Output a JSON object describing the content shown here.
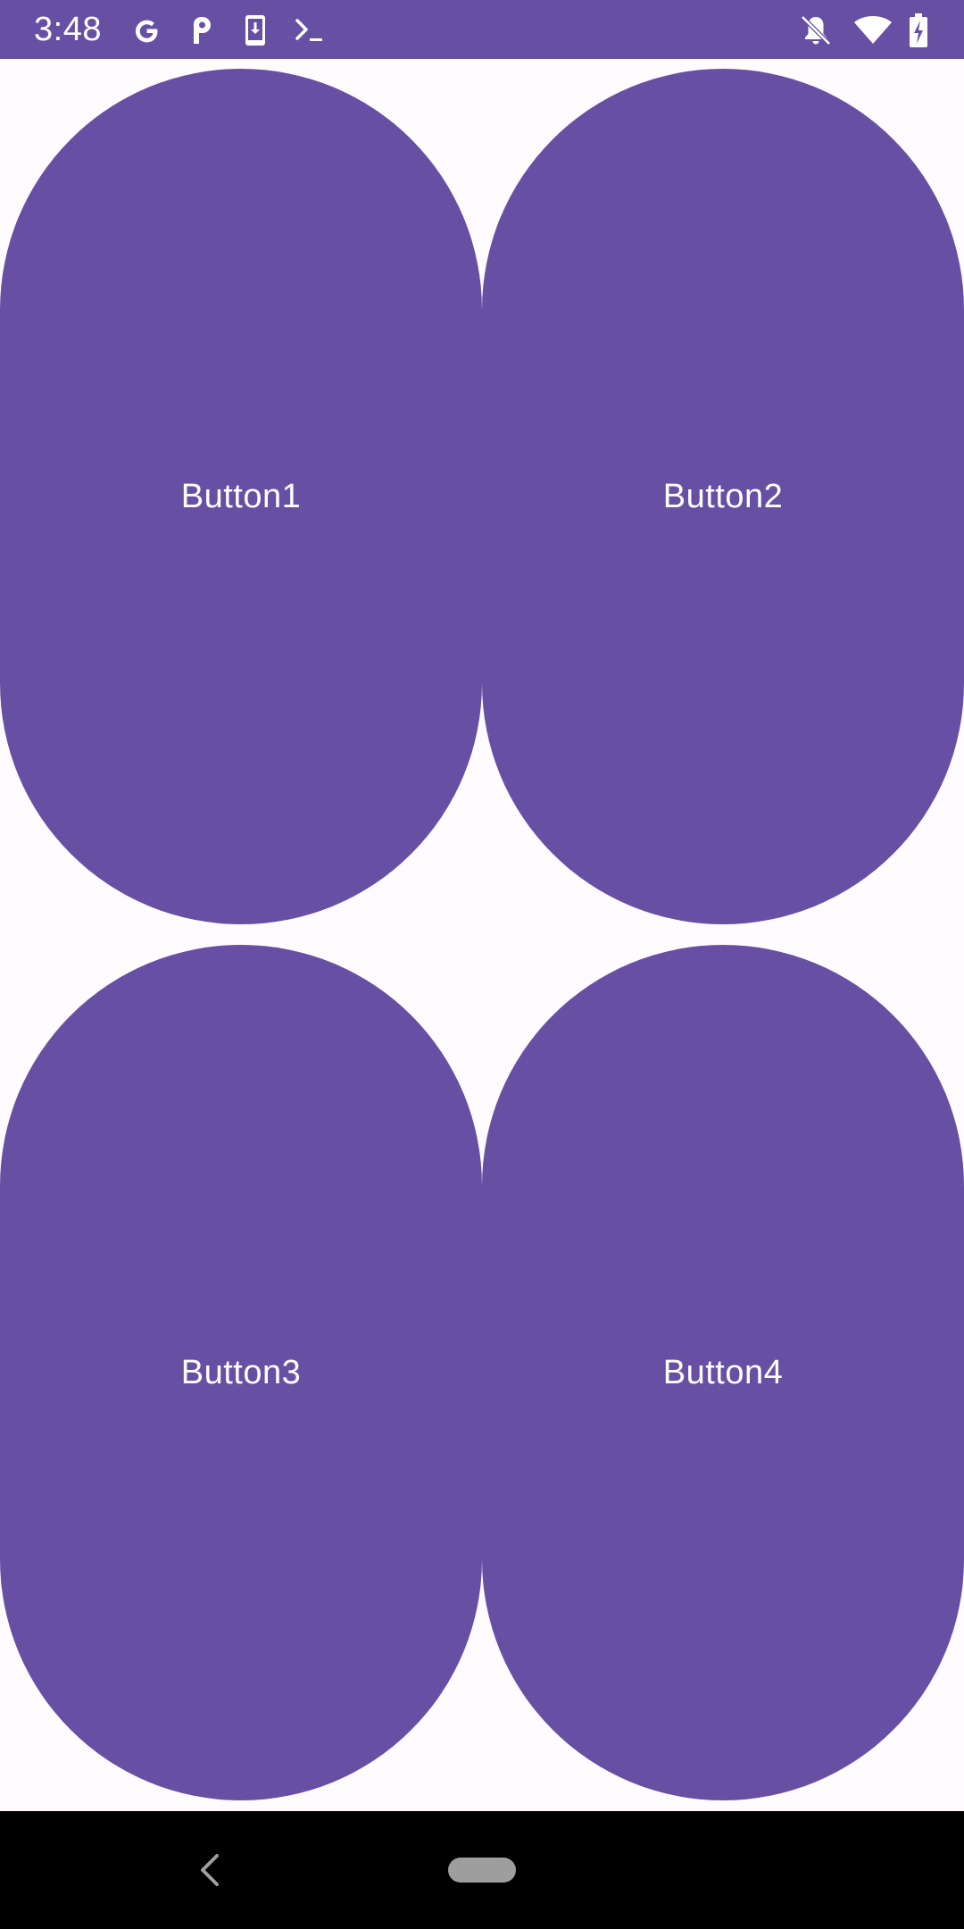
{
  "status_bar": {
    "time": "3:48",
    "background_color": "#6750A4",
    "left_icons": [
      "google-icon",
      "p-app-icon",
      "download-to-device-icon",
      "terminal-icon"
    ],
    "right_icons": [
      "notifications-off-icon",
      "wifi-icon",
      "battery-charging-icon"
    ]
  },
  "buttons": [
    {
      "label": "Button1"
    },
    {
      "label": "Button2"
    },
    {
      "label": "Button3"
    },
    {
      "label": "Button4"
    }
  ],
  "theme": {
    "primary": "#6750A4",
    "on_primary": "#FFFFFF",
    "background": "#FFFBFE",
    "nav_bar": "#000000"
  },
  "nav_bar": {
    "icons": [
      "back-icon",
      "home-pill-icon"
    ]
  }
}
